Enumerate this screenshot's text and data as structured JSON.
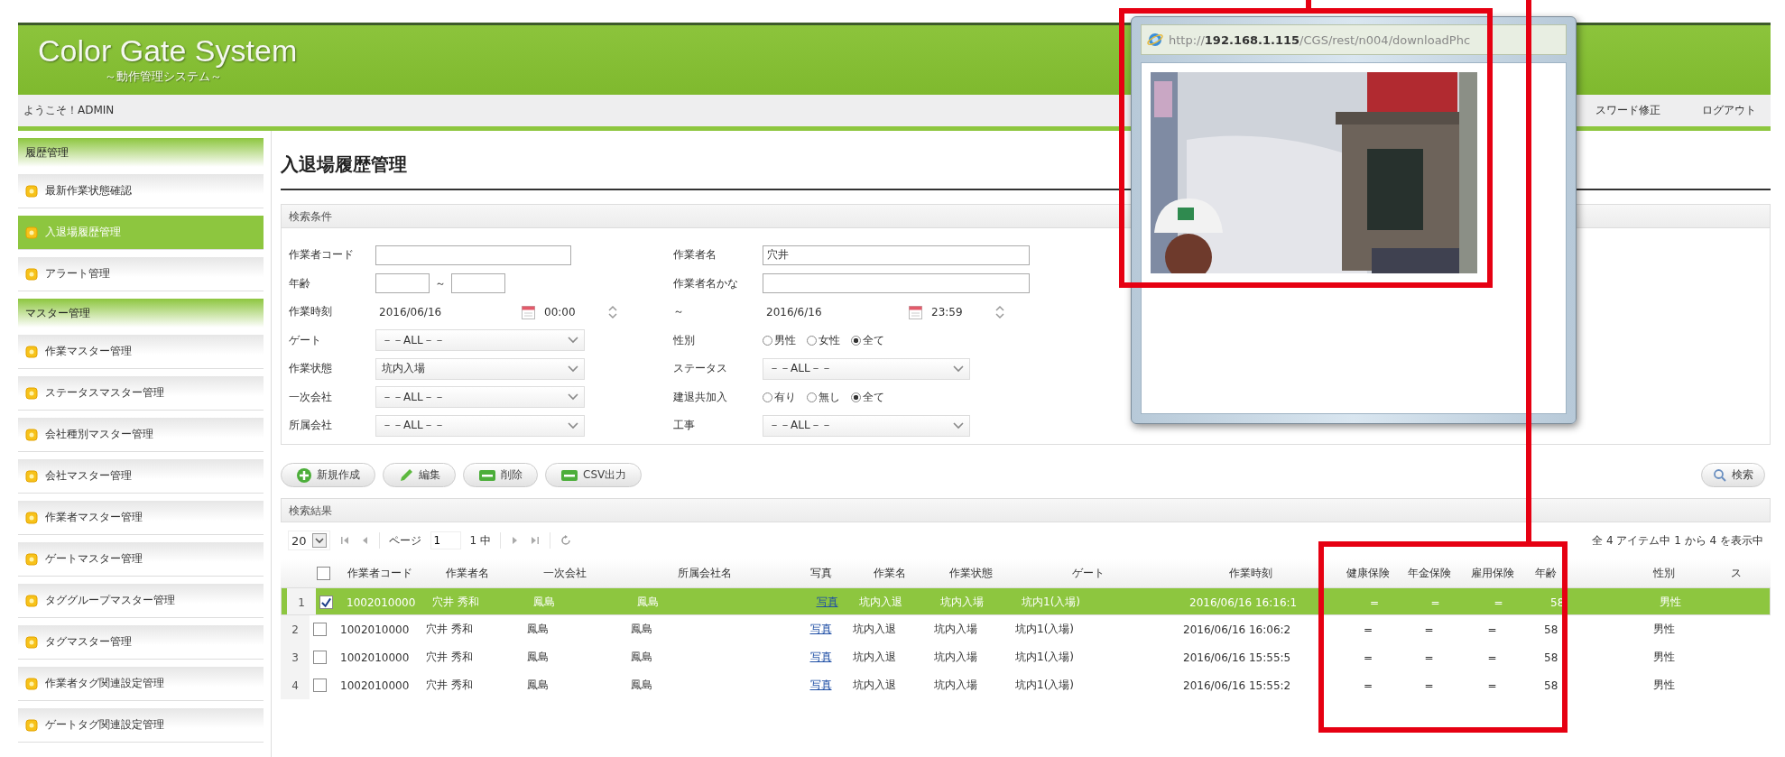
{
  "header": {
    "title": "Color Gate System",
    "subtitle": "～動作管理システム～"
  },
  "user_bar": {
    "welcome": "ようこそ！ADMIN",
    "links": [
      "スワード修正",
      "ログアウト"
    ]
  },
  "sidebar": {
    "sections": [
      {
        "title": "履歴管理",
        "items": [
          {
            "label": "最新作業状態確認",
            "selected": false
          },
          {
            "label": "入退場履歴管理",
            "selected": true
          },
          {
            "label": "アラート管理",
            "selected": false
          }
        ]
      },
      {
        "title": "マスター管理",
        "items": [
          {
            "label": "作業マスター管理",
            "selected": false
          },
          {
            "label": "ステータスマスター管理",
            "selected": false
          },
          {
            "label": "会社種別マスター管理",
            "selected": false
          },
          {
            "label": "会社マスター管理",
            "selected": false
          },
          {
            "label": "作業者マスター管理",
            "selected": false
          },
          {
            "label": "ゲートマスター管理",
            "selected": false
          },
          {
            "label": "タググループマスター管理",
            "selected": false
          },
          {
            "label": "タグマスター管理",
            "selected": false
          },
          {
            "label": "作業者タグ関連設定管理",
            "selected": false
          },
          {
            "label": "ゲートタグ関連設定管理",
            "selected": false
          }
        ]
      }
    ]
  },
  "page_title": "入退場履歴管理",
  "search": {
    "title": "検索条件",
    "left": [
      {
        "kind": "text",
        "label": "作業者コード"
      },
      {
        "kind": "range",
        "label": "年齢",
        "separator": "～"
      },
      {
        "kind": "datetime",
        "label": "作業時刻",
        "date": "2016/06/16",
        "time": "00:00"
      },
      {
        "kind": "select",
        "label": "ゲート",
        "value": "－－ALL－－"
      },
      {
        "kind": "select",
        "label": "作業状態",
        "value": "坑内入場"
      },
      {
        "kind": "select",
        "label": "一次会社",
        "value": "－－ALL－－"
      },
      {
        "kind": "select",
        "label": "所属会社",
        "value": "－－ALL－－"
      }
    ],
    "right": [
      {
        "kind": "text",
        "label": "作業者名",
        "value": "穴井"
      },
      {
        "kind": "text",
        "label": "作業者名かな"
      },
      {
        "kind": "datetime",
        "label": "～",
        "date": "2016/6/16",
        "time": "23:59"
      },
      {
        "kind": "radio",
        "label": "性別",
        "options": [
          {
            "label": "男性",
            "selected": false
          },
          {
            "label": "女性",
            "selected": false
          },
          {
            "label": "全て",
            "selected": true
          }
        ]
      },
      {
        "kind": "select",
        "label": "ステータス",
        "value": "－－ALL－－"
      },
      {
        "kind": "radio",
        "label": "建退共加入",
        "options": [
          {
            "label": "有り",
            "selected": false
          },
          {
            "label": "無し",
            "selected": false
          },
          {
            "label": "全て",
            "selected": true
          }
        ]
      },
      {
        "kind": "select",
        "label": "工事",
        "value": "－－ALL－－"
      }
    ]
  },
  "actions": [
    {
      "kind": "add",
      "label": "新規作成"
    },
    {
      "kind": "edit",
      "label": "編集"
    },
    {
      "kind": "delete",
      "label": "削除"
    },
    {
      "kind": "export",
      "label": "CSV出力"
    }
  ],
  "search_button": {
    "label": "検索"
  },
  "results": {
    "title": "検索結果",
    "pager": {
      "page_size": "20",
      "page_label": "ページ",
      "page": "1",
      "of": "1 中",
      "summary": "全 4 アイテム中 1 から 4 を表示中"
    },
    "all_checked": false,
    "columns": [
      {
        "label": "作業者コード"
      },
      {
        "label": "作業者名"
      },
      {
        "label": "一次会社"
      },
      {
        "label": "所属会社名"
      },
      {
        "label": "写真",
        "kind": "link"
      },
      {
        "label": "作業名"
      },
      {
        "label": "作業状態"
      },
      {
        "label": "ゲート"
      },
      {
        "label": "作業時刻"
      },
      {
        "label": "健康保険"
      },
      {
        "label": "年金保険"
      },
      {
        "label": "雇用保険"
      },
      {
        "label": "年齢"
      },
      {
        "label": "性別"
      },
      {
        "label": "ス"
      }
    ],
    "rows": [
      {
        "number": "1",
        "selected": true,
        "checked": true,
        "cells": [
          "1002010000",
          "穴井 秀和",
          "鳳島",
          "鳳島",
          "写真",
          "坑内入退",
          "坑内入場",
          "坑内1(入場)",
          "2016/06/16 16:16:1",
          "=",
          "=",
          "=",
          "58",
          "男性"
        ]
      },
      {
        "number": "2",
        "selected": false,
        "checked": false,
        "cells": [
          "1002010000",
          "穴井 秀和",
          "鳳島",
          "鳳島",
          "写真",
          "坑内入退",
          "坑内入場",
          "坑内1(入場)",
          "2016/06/16 16:06:2",
          "=",
          "=",
          "=",
          "58",
          "男性"
        ]
      },
      {
        "number": "3",
        "selected": false,
        "checked": false,
        "cells": [
          "1002010000",
          "穴井 秀和",
          "鳳島",
          "鳳島",
          "写真",
          "坑内入退",
          "坑内入場",
          "坑内1(入場)",
          "2016/06/16 15:55:5",
          "=",
          "=",
          "=",
          "58",
          "男性"
        ]
      },
      {
        "number": "4",
        "selected": false,
        "checked": false,
        "cells": [
          "1002010000",
          "穴井 秀和",
          "鳳島",
          "鳳島",
          "写真",
          "坑内入退",
          "坑内入場",
          "坑内1(入場)",
          "2016/06/16 15:55:2",
          "=",
          "=",
          "=",
          "58",
          "男性"
        ]
      }
    ]
  },
  "popup": {
    "address": "http://**192.168.1.115**/CGS/rest/n004/downloadPhc"
  }
}
